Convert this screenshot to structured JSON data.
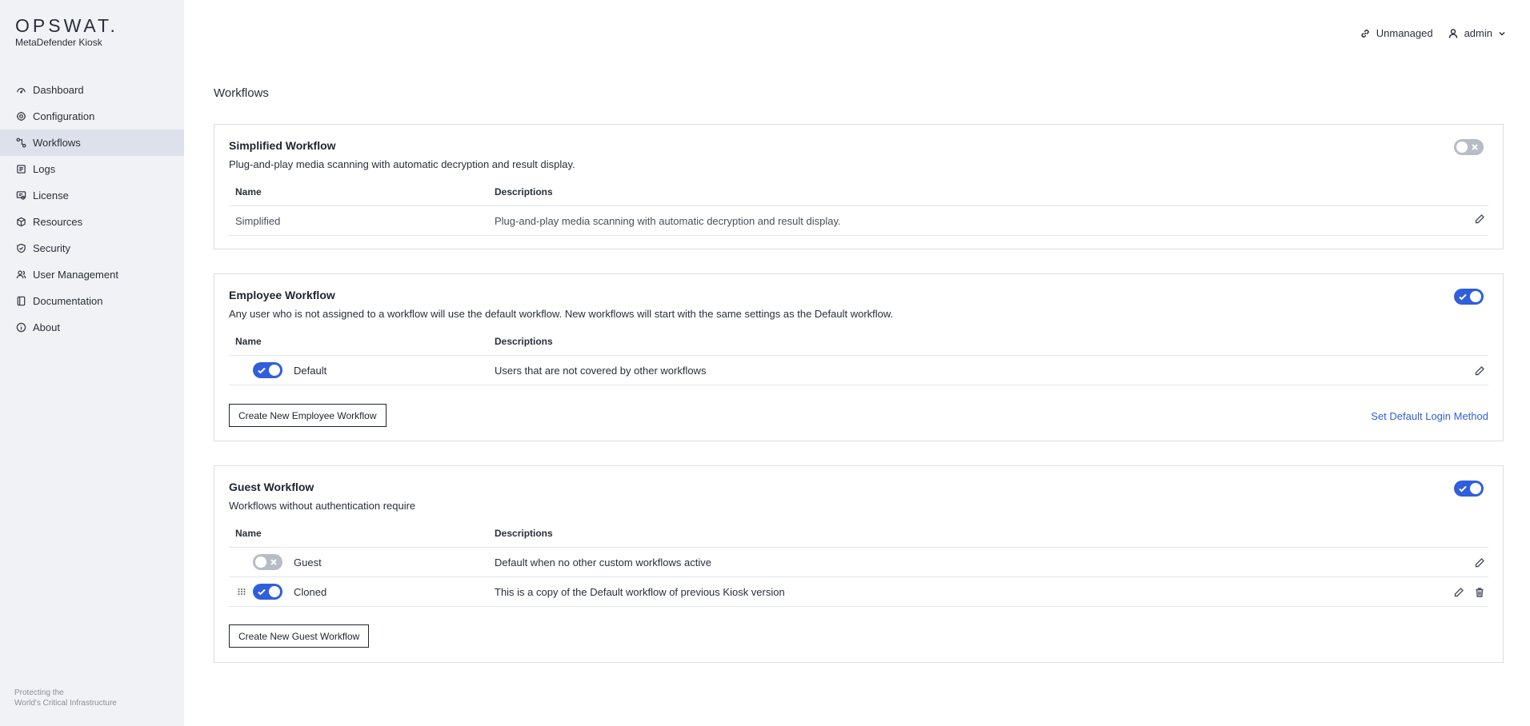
{
  "brand": {
    "logo": "OPSWAT.",
    "product": "MetaDefender Kiosk"
  },
  "nav": [
    {
      "label": "Dashboard",
      "icon": "dashboard-icon",
      "active": false
    },
    {
      "label": "Configuration",
      "icon": "gear-icon",
      "active": false
    },
    {
      "label": "Workflows",
      "icon": "workflow-icon",
      "active": true
    },
    {
      "label": "Logs",
      "icon": "logs-icon",
      "active": false
    },
    {
      "label": "License",
      "icon": "license-icon",
      "active": false
    },
    {
      "label": "Resources",
      "icon": "cube-icon",
      "active": false
    },
    {
      "label": "Security",
      "icon": "shield-icon",
      "active": false
    },
    {
      "label": "User Management",
      "icon": "users-icon",
      "active": false
    },
    {
      "label": "Documentation",
      "icon": "book-icon",
      "active": false
    },
    {
      "label": "About",
      "icon": "info-icon",
      "active": false
    }
  ],
  "tagline": {
    "line1": "Protecting the",
    "line2": "World's Critical Infrastructure"
  },
  "topbar": {
    "managed_status": "Unmanaged",
    "user": "admin"
  },
  "page": {
    "title": "Workflows"
  },
  "simplified": {
    "title": "Simplified Workflow",
    "description": "Plug-and-play media scanning with automatic decryption and result display.",
    "enabled": false,
    "headers": {
      "name": "Name",
      "desc": "Descriptions"
    },
    "rows": [
      {
        "name": "Simplified",
        "description": "Plug-and-play media scanning with automatic decryption and result display."
      }
    ]
  },
  "employee": {
    "title": "Employee Workflow",
    "description": "Any user who is not assigned to a workflow will use the default workflow. New workflows will start with the same settings as the Default workflow.",
    "enabled": true,
    "headers": {
      "name": "Name",
      "desc": "Descriptions"
    },
    "rows": [
      {
        "name": "Default",
        "description": "Users that are not covered by other workflows",
        "enabled": true
      }
    ],
    "create_button": "Create New Employee Workflow",
    "login_link": "Set Default Login Method"
  },
  "guest": {
    "title": "Guest Workflow",
    "description": "Workflows without authentication require",
    "enabled": true,
    "headers": {
      "name": "Name",
      "desc": "Descriptions"
    },
    "rows": [
      {
        "name": "Guest",
        "description": "Default when no other custom workflows active",
        "enabled": false
      },
      {
        "name": "Cloned",
        "description": "This is a copy of the Default workflow of previous Kiosk version",
        "enabled": true
      }
    ],
    "create_button": "Create New Guest Workflow"
  },
  "colors": {
    "accent": "#2f5fdc",
    "sidebar_bg": "#f1f2f6",
    "active_nav": "#dde1ec"
  }
}
